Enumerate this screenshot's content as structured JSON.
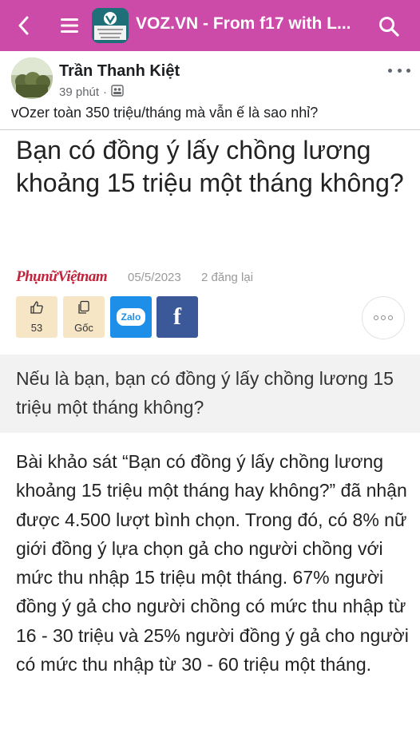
{
  "topbar": {
    "title": "VOZ.VN - From f17 with L...",
    "bg_color": "#cc4aa8",
    "icons": [
      "back-arrow-icon",
      "hamburger-menu-icon",
      "search-icon"
    ]
  },
  "post": {
    "author": "Trần Thanh Kiệt",
    "time": "39 phút",
    "separator": "·",
    "audience_icon": "group-icon",
    "text": "vOzer toàn 350 triệu/tháng mà vẫn ế là sao nhỉ?"
  },
  "article": {
    "title": "Bạn có đồng ý lấy chồng lương khoảng 15 triệu một tháng không?",
    "source_logo": "PhụnữViệtnam",
    "date": "05/5/2023",
    "repost_count": "2 đăng lại",
    "like_count": "53",
    "original_label": "Gốc",
    "zalo_label": "Zalo",
    "facebook_label": "f",
    "sapo": "Nếu là bạn, bạn có đồng ý lấy chồng lương 15 triệu một tháng không?",
    "body": "Bài khảo sát “Bạn có đồng ý lấy chồng lương khoảng 15 triệu một tháng hay không?” đã nhận được 4.500 lượt bình chọn. Trong đó, có 8% nữ giới đồng ý lựa chọn gả cho người chồng với mức thu nhập 15 triệu một tháng. 67% người đồng ý gả cho người chồng có mức thu nhập từ 16 - 30 triệu và 25% người đồng ý gả cho người có mức thu nhập từ 30 - 60 triệu một tháng."
  },
  "colors": {
    "accent": "#cc4aa8",
    "source_red": "#c2233a",
    "button_beige": "#f6e6c6",
    "zalo_blue": "#1d8fe8",
    "facebook_blue": "#3b5998",
    "sapo_bg": "#f2f2f2"
  }
}
